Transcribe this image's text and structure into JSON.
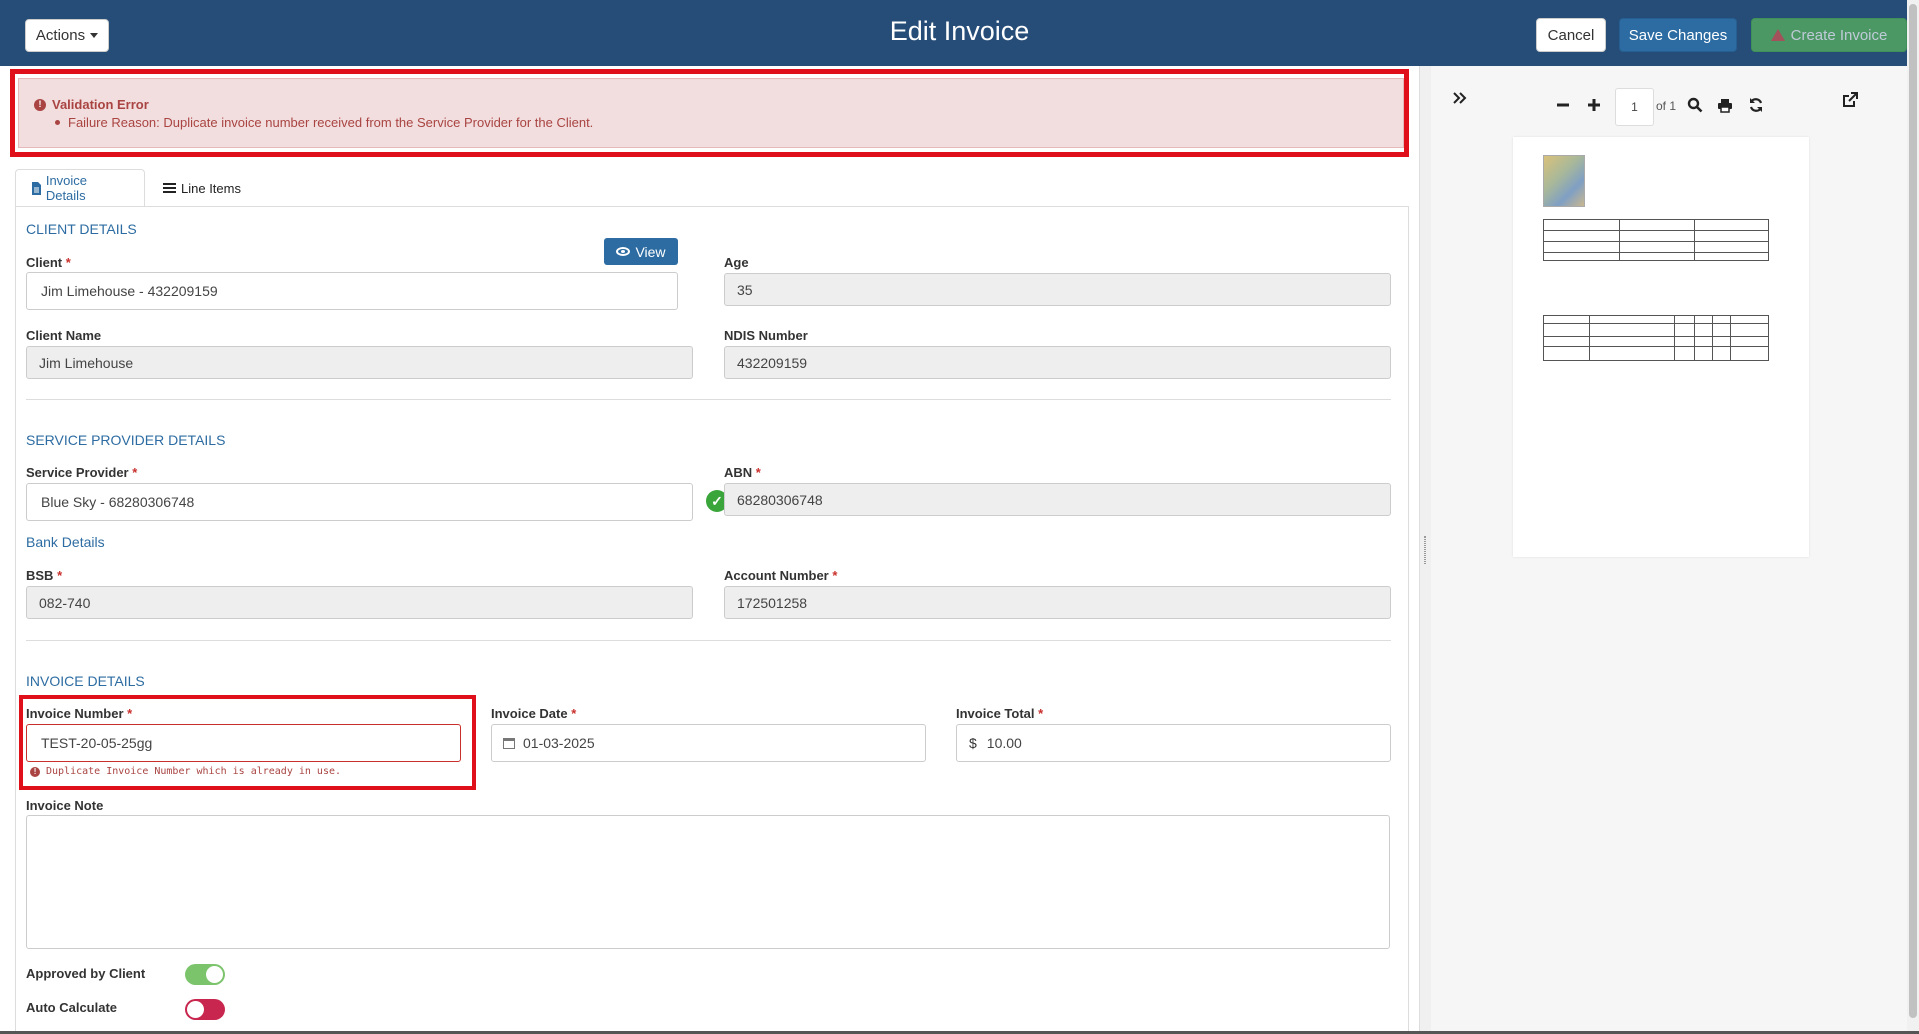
{
  "header": {
    "title": "Edit Invoice",
    "actions_label": "Actions",
    "cancel_label": "Cancel",
    "save_label": "Save Changes",
    "create_label": "Create Invoice"
  },
  "alert": {
    "title": "Validation Error",
    "message": "Failure Reason: Duplicate invoice number received from the Service Provider for the Client."
  },
  "tabs": [
    {
      "label": "Invoice Details"
    },
    {
      "label": "Line Items"
    }
  ],
  "client_details": {
    "section_title": "CLIENT DETAILS",
    "view_label": "View",
    "client_label": "Client",
    "client_value": "Jim Limehouse - 432209159",
    "age_label": "Age",
    "age_value": "35",
    "client_name_label": "Client Name",
    "client_name_value": "Jim Limehouse",
    "ndis_label": "NDIS Number",
    "ndis_value": "432209159"
  },
  "provider_details": {
    "section_title": "SERVICE PROVIDER DETAILS",
    "provider_label": "Service Provider",
    "provider_value": "Blue Sky - 68280306748",
    "abn_label": "ABN",
    "abn_value": "68280306748",
    "bank_details_label": "Bank Details",
    "bsb_label": "BSB",
    "bsb_value": "082-740",
    "account_label": "Account Number",
    "account_value": "172501258"
  },
  "invoice_details": {
    "section_title": "INVOICE DETAILS",
    "number_label": "Invoice Number",
    "number_value": "TEST-20-05-25gg",
    "number_error": "Duplicate Invoice Number which is already in use.",
    "date_label": "Invoice Date",
    "date_value": "01-03-2025",
    "total_label": "Invoice Total",
    "currency_symbol": "$",
    "total_value": "10.00",
    "note_label": "Invoice Note",
    "note_value": "",
    "approved_label": "Approved by Client",
    "approved_on": true,
    "auto_calc_label": "Auto Calculate",
    "auto_calc_on": false
  },
  "preview": {
    "page_number": "1",
    "page_of": "of 1"
  },
  "colors": {
    "header_bg": "#264d78",
    "primary": "#2d6ca2",
    "error": "#a94442",
    "highlight_box": "#e0101a",
    "toggle_on": "#7cc46c",
    "toggle_off": "#c8264e"
  },
  "icons": [
    "caret-down-icon",
    "warning-icon",
    "error-circle-icon",
    "file-icon",
    "list-icon",
    "eye-icon",
    "check-circle-icon",
    "calendar-icon",
    "chevrons-right-icon",
    "minus-icon",
    "plus-icon",
    "search-icon",
    "print-icon",
    "refresh-icon",
    "external-link-icon"
  ]
}
